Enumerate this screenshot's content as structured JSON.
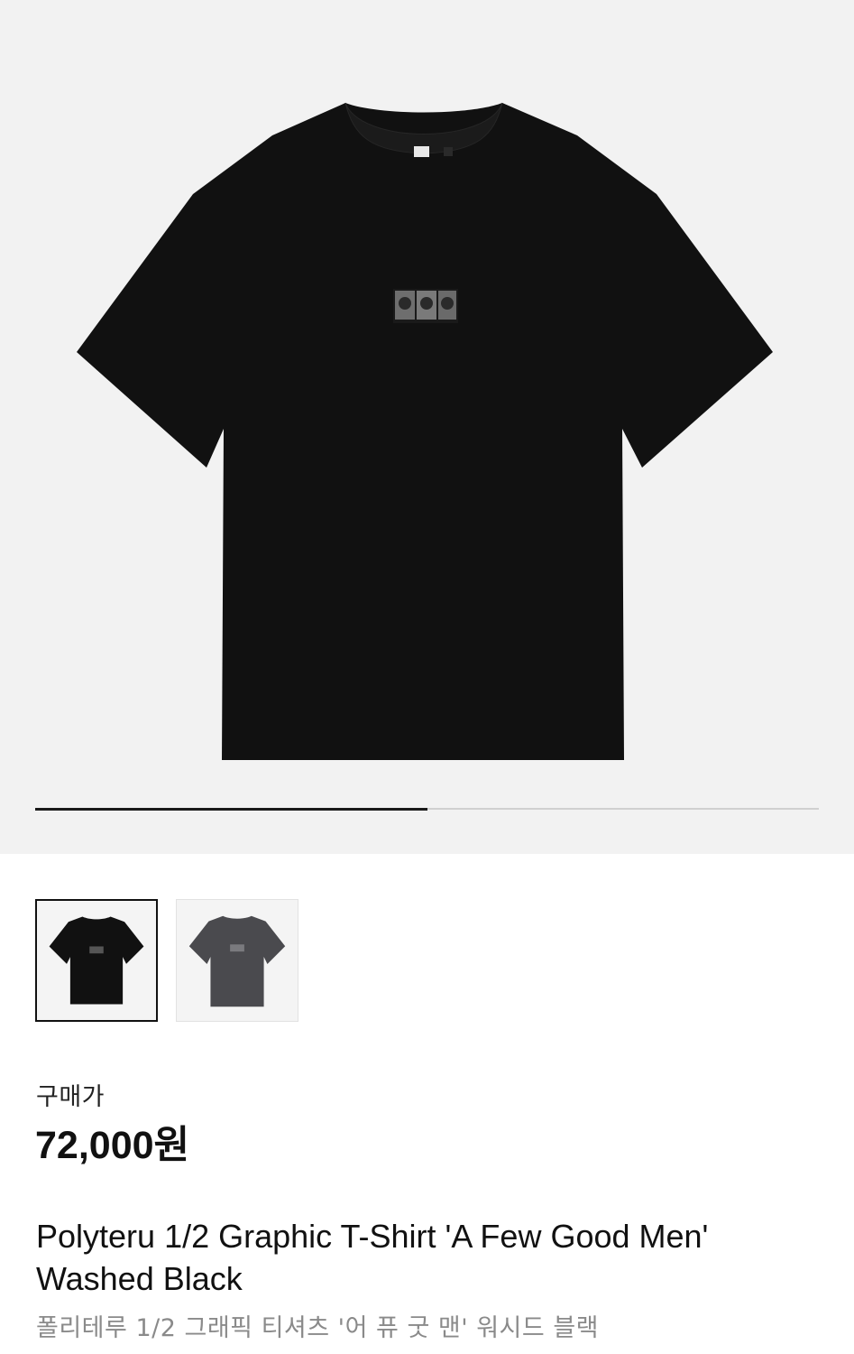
{
  "gallery": {
    "main_image_alt": "Polyteru 1/2 Graphic T-Shirt 'A Few Good Men' Washed Black",
    "progress": 0.5,
    "thumbnails": [
      {
        "name": "black-tshirt",
        "color": "#111111",
        "selected": true
      },
      {
        "name": "washed-gray-tshirt",
        "color": "#4a4a4e",
        "selected": false
      }
    ]
  },
  "price": {
    "label": "구매가",
    "value": "72,000원"
  },
  "product": {
    "name_en": "Polyteru 1/2 Graphic T-Shirt 'A Few Good Men' Washed Black",
    "name_ko": "폴리테루 1/2 그래픽 티셔츠 '어 퓨 굿 맨' 워시드 블랙"
  },
  "colors": {
    "hero_background": "#f2f2f2",
    "shirt_black": "#111111",
    "shirt_washed": "#4a4a4e",
    "subtext": "#8a8a8a"
  }
}
